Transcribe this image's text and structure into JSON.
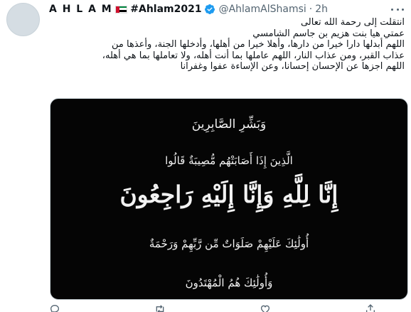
{
  "tweet": {
    "author": {
      "display_name": "A H L A M",
      "hashtag": "#Ahlam2021",
      "handle": "@AhlamAlShamsi",
      "separator": "·",
      "timestamp": "2h",
      "flag": "uae-flag-icon",
      "verified": "verified-badge-icon"
    },
    "text_lines": [
      "انتقلت إلى رحمة الله تعالى",
      "عمتي هيا بنت هزيم بن جاسم الشامسي",
      "اللهم أبدلها دارا خيرا من دارها، وأهلا خيرا من أهلها، وأدخلها الجنة، وأعذها من",
      "عذاب القبر، ومن عذاب النار، اللهم عاملها بما أنت أهله، ولا تعاملها بما هي أهله،",
      "اللهم اجزها عن الإحسان إحسانا، وعن الإساءة عفوا وغفرانا"
    ],
    "image": {
      "calligraphy": [
        "وَبَشِّرِ الصَّابِرِينَ",
        "الَّذِينَ إِذَا أَصَابَتْهُم مُّصِيبَةٌ قَالُوا",
        "إِنَّا لِلَّهِ وَإِنَّا إِلَيْهِ رَاجِعُونَ",
        "أُولَٰئِكَ عَلَيْهِمْ صَلَوَاتٌ مِّن رَّبِّهِمْ وَرَحْمَةٌ",
        "وَأُولَٰئِكَ هُمُ الْمُهْتَدُونَ"
      ]
    },
    "actions": {
      "reply": "reply-icon",
      "retweet": "retweet-icon",
      "like": "like-icon",
      "share": "share-icon"
    },
    "colors": {
      "text": "#0f1419",
      "secondary": "#536471",
      "verified": "#1d9bf0",
      "image_bg": "#050505"
    }
  }
}
